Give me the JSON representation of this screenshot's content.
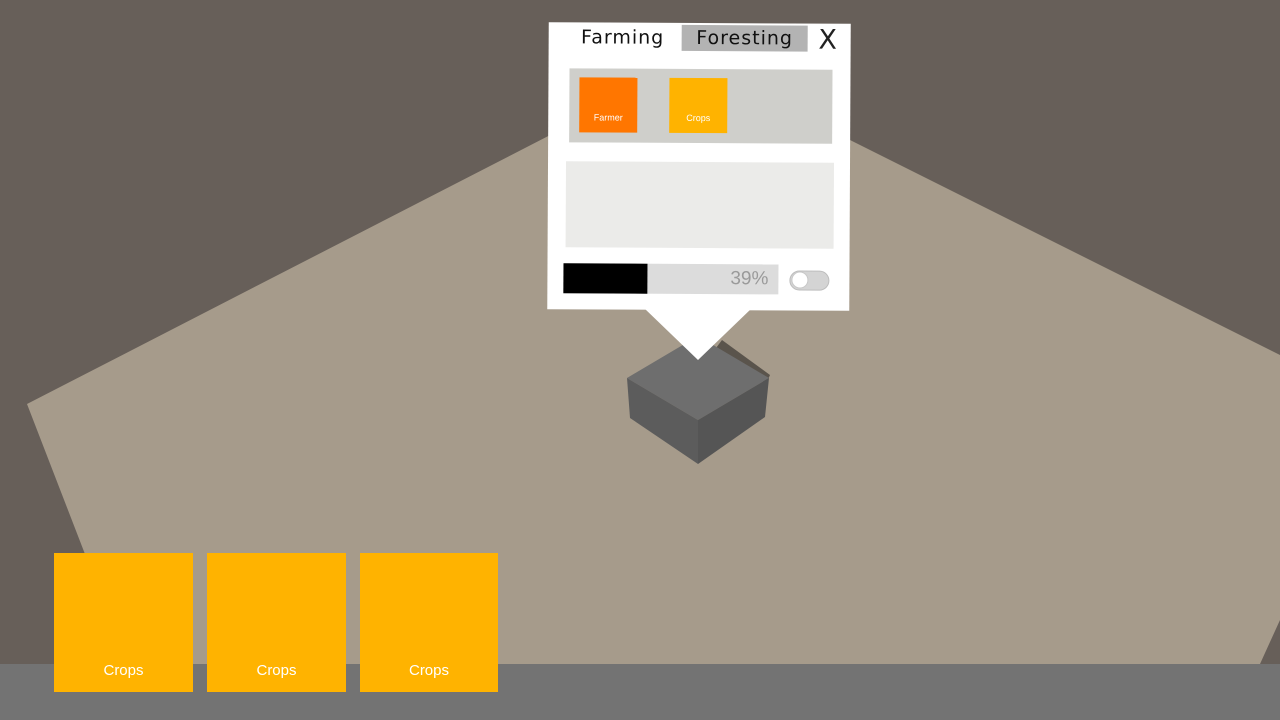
{
  "popup": {
    "tabs": [
      {
        "label": "Farming",
        "active": true
      },
      {
        "label": "Foresting",
        "active": false
      }
    ],
    "close_label": "X",
    "items": [
      {
        "label": "Farmer",
        "color": "#ff7600"
      },
      {
        "label": "Crops",
        "color": "#ffb300"
      }
    ],
    "progress": {
      "value": 0.39,
      "label": "39%"
    },
    "toggle": {
      "on": false
    }
  },
  "hotbar": {
    "slots": [
      {
        "label": "Crops",
        "color": "#ffb300"
      },
      {
        "label": "Crops",
        "color": "#ffb300"
      },
      {
        "label": "Crops",
        "color": "#ffb300"
      }
    ]
  },
  "colors": {
    "background": "#675f59",
    "floor": "#a69b8b",
    "ground_strip": "#737373",
    "block_top": "#6e6e6e"
  }
}
